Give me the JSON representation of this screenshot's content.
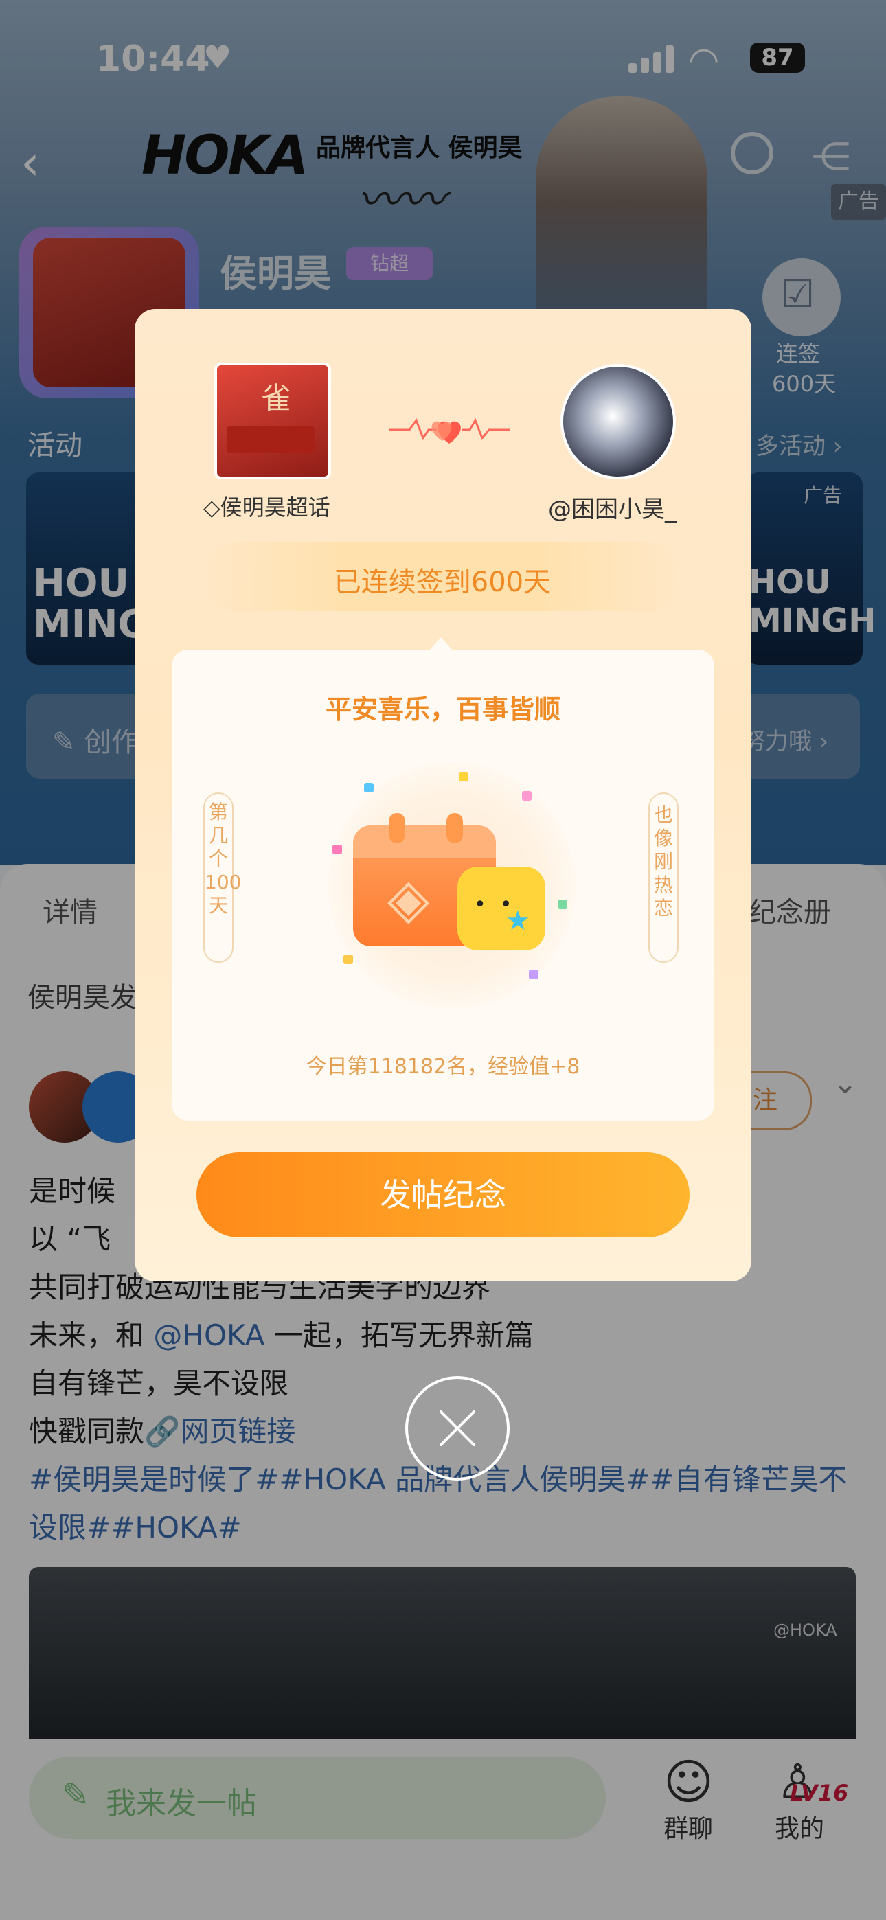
{
  "status_bar": {
    "time": "10:44",
    "battery": "87"
  },
  "header": {
    "brand_logo": "HOKA",
    "brand_line": "品牌代言人 侯明昊",
    "ad_tag": "广告"
  },
  "profile": {
    "name": "侯明昊",
    "tier_badge": "钻超",
    "checkin_label": "连签",
    "checkin_days": "600天"
  },
  "activity": {
    "title": "活动",
    "more": "多活动 ›",
    "ad_tag": "广告",
    "card_left_text": "HOU\nMINGH",
    "card_right_text": "HOU\nMINGH"
  },
  "create_bar": {
    "label": "创作",
    "right_text": "努力哦 ›"
  },
  "tabs": {
    "detail": "详情",
    "album": "纪念册"
  },
  "post": {
    "head": "侯明昊发",
    "follow": "关注",
    "line1": "是时候",
    "line2": "以 “飞",
    "line3": "共同打破运动性能与生活美学的边界",
    "line4_prefix": "未来，和 ",
    "line4_link": "@HOKA",
    "line4_suffix": " 一起，拓写无界新篇",
    "line5": "自有锋芒，昊不设限",
    "line6_prefix": "快戳同款",
    "line6_link": "网页链接",
    "hashtags": "#侯明昊是时候了##HOKA 品牌代言人侯明昊##自有锋芒昊不设限##HOKA#",
    "image_tag": "@HOKA"
  },
  "bottom_bar": {
    "compose": "我来发一帖",
    "group_chat": "群聊",
    "me": "我的",
    "level": "LV16"
  },
  "modal": {
    "left_label": "侯明昊超话",
    "right_label": "@困困小昊_",
    "streak": "已连续签到600天",
    "card_title": "平安喜乐，百事皆顺",
    "side_left": "第几个100天",
    "side_right": "也像刚热恋",
    "rank": "今日第118182名，经验值+8",
    "post_button": "发帖纪念"
  },
  "colors": {
    "accent_orange": "#f08a24",
    "button_gradient_start": "#ff8a1a",
    "button_gradient_end": "#ffb52e",
    "link_blue": "#3a6eb3",
    "level_red": "#d2193c"
  }
}
